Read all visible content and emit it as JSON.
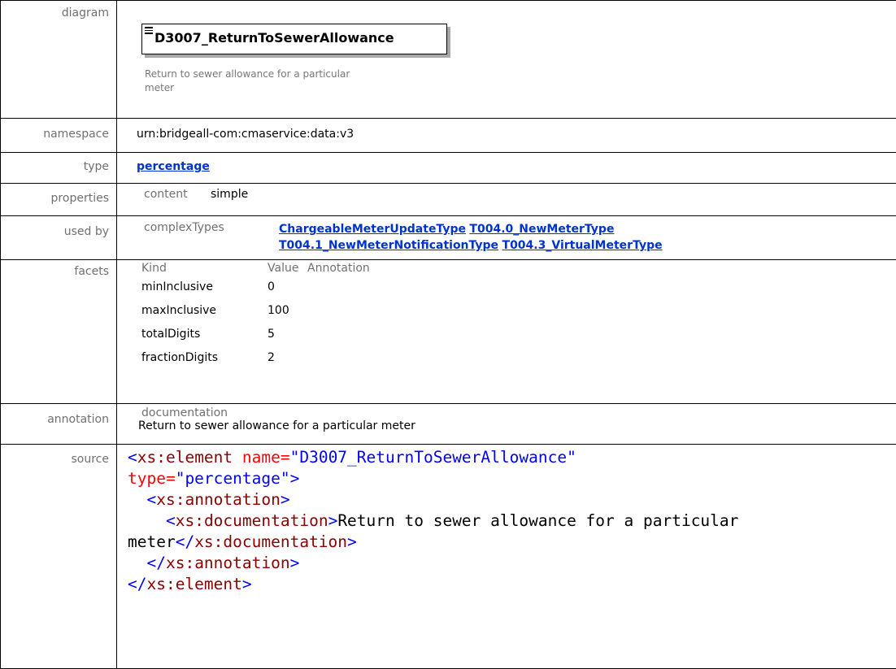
{
  "diagram": {
    "label": "diagram",
    "element_name": "D3007_ReturnToSewerAllowance",
    "element_doc_line1": "Return to sewer allowance for a particular",
    "element_doc_line2": "meter"
  },
  "namespace": {
    "label": "namespace",
    "value": "urn:bridgeall-com:cmaservice:data:v3"
  },
  "type": {
    "label": "type",
    "value": "percentage"
  },
  "properties": {
    "label": "properties",
    "key": "content",
    "value": "simple"
  },
  "used_by": {
    "label": "used by",
    "key": "complexTypes",
    "links": [
      "ChargeableMeterUpdateType",
      "T004.0_NewMeterType",
      "T004.1_NewMeterNotificationType",
      "T004.3_VirtualMeterType"
    ]
  },
  "facets": {
    "label": "facets",
    "headers": [
      "Kind",
      "Value",
      "Annotation"
    ],
    "rows": [
      {
        "kind": "minInclusive",
        "value": "0"
      },
      {
        "kind": "maxInclusive",
        "value": "100"
      },
      {
        "kind": "totalDigits",
        "value": "5"
      },
      {
        "kind": "fractionDigits",
        "value": "2"
      }
    ]
  },
  "annotation": {
    "label": "annotation",
    "key": "documentation",
    "text": "Return to sewer allowance for a particular meter"
  },
  "source": {
    "label": "source",
    "lines": [
      {
        "indent": "",
        "open": "<",
        "tag": "xs:element",
        "attr1": " name=",
        "val1": "\"D3007_ReturnToSewerAllowance\""
      },
      {
        "attr": "type=",
        "val": "\"percentage\"",
        "close": ">"
      },
      {
        "indent": "  ",
        "open": "<",
        "tag": "xs:annotation",
        "close": ">"
      },
      {
        "indent": "    ",
        "open": "<",
        "tag": "xs:documentation",
        "close": ">",
        "text": "Return to sewer allowance for a particular"
      },
      {
        "text": "meter",
        "open": "</",
        "tag": "xs:documentation",
        "close": ">"
      },
      {
        "indent": "  ",
        "open": "</",
        "tag": "xs:annotation",
        "close": ">"
      },
      {
        "open": "</",
        "tag": "xs:element",
        "close": ">"
      }
    ]
  }
}
